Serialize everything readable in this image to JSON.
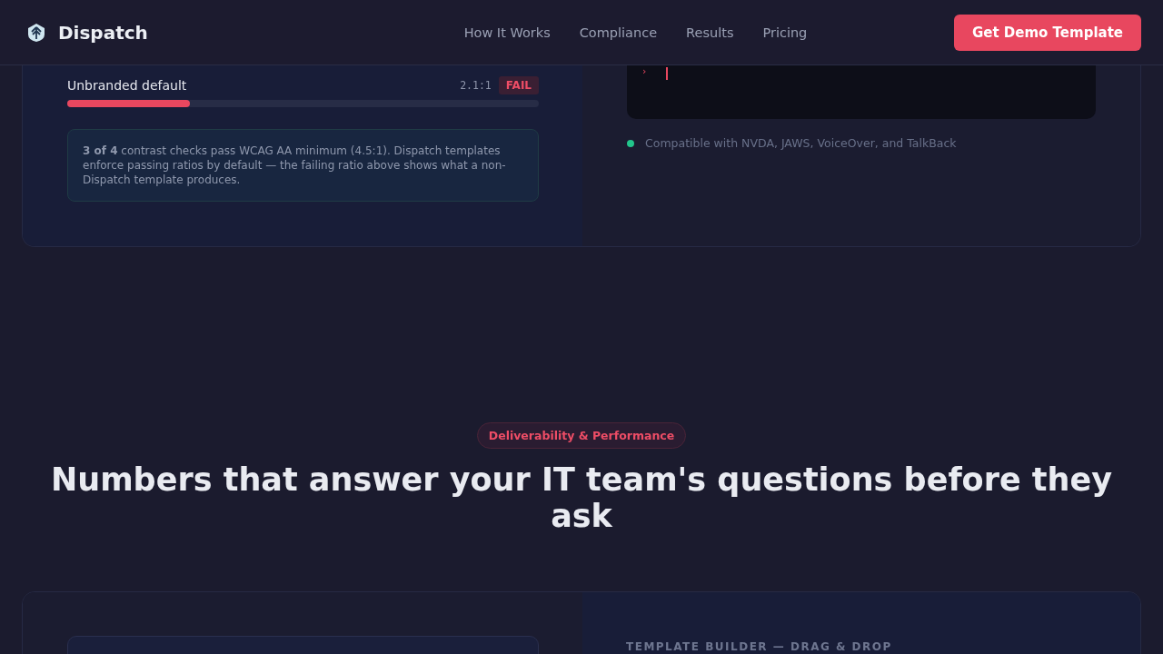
{
  "header": {
    "brand": "Dispatch",
    "nav": [
      "How It Works",
      "Compliance",
      "Results",
      "Pricing"
    ],
    "cta": "Get Demo Template"
  },
  "contrast_card": {
    "check": {
      "label": "Unbranded default",
      "ratio": "2.1:1",
      "result": "FAIL",
      "level": 0.26
    },
    "note": "**3 of 4** contrast checks pass WCAG AA minimum (4.5:1). Dispatch templates enforce passing ratios by default — the failing ratio above shows what a non-Dispatch template produces.",
    "terminal": {
      "prompt": "›"
    },
    "compat": {
      "text": "Compatible with NVDA, JAWS, VoiceOver, and TalkBack",
      "color": "#22c58b"
    }
  },
  "section": {
    "pill": "Deliverability & Performance",
    "heading": "Numbers that answer your IT team's questions before they ask"
  },
  "builder_card": {
    "label": "TEMPLATE BUILDER — DRAG & DROP"
  }
}
